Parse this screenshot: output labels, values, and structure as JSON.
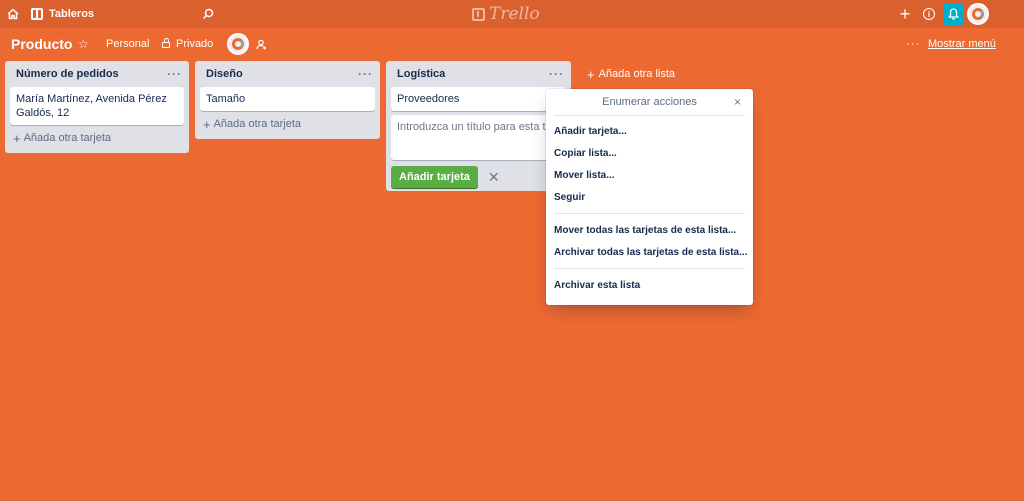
{
  "topbar": {
    "home_icon": "home-icon",
    "boards_label": "Tableros",
    "search_icon": "search-icon",
    "logo_text": "Trello",
    "plus_icon": "plus-icon",
    "info_icon": "info-icon",
    "bell_icon": "bell-icon",
    "accent_color": "#00aecc"
  },
  "board": {
    "title": "Producto",
    "star_icon": "star-icon",
    "team_label": "Personal",
    "visibility_label": "Privado",
    "invite_icon": "invite-icon",
    "menu_dots": "···",
    "menu_label": "Mostrar menú",
    "background_color": "#ed6932"
  },
  "lists": [
    {
      "title": "Número de pedidos",
      "menu": "···",
      "cards": [
        "María Martínez, Avenida Pérez Galdós, 12"
      ],
      "add_card": "Añada otra tarjeta"
    },
    {
      "title": "Diseño",
      "menu": "···",
      "cards": [
        "Tamaño"
      ],
      "add_card": "Añada otra tarjeta"
    },
    {
      "title": "Logística",
      "menu": "···",
      "cards": [
        "Proveedores"
      ],
      "composer_placeholder": "Introduzca un título para esta tarjeta…",
      "add_button": "Añadir tarjeta",
      "cancel": "✕"
    }
  ],
  "add_list": "Añada otra lista",
  "popover": {
    "title": "Enumerar acciones",
    "close": "×",
    "group1": [
      "Añadir tarjeta...",
      "Copiar lista...",
      "Mover lista...",
      "Seguir"
    ],
    "group2": [
      "Mover todas las tarjetas de esta lista...",
      "Archivar todas las tarjetas de esta lista..."
    ],
    "group3": [
      "Archivar esta lista"
    ]
  },
  "colors": {
    "green_button": "#5aac44",
    "list_bg": "#dfe1e6"
  }
}
